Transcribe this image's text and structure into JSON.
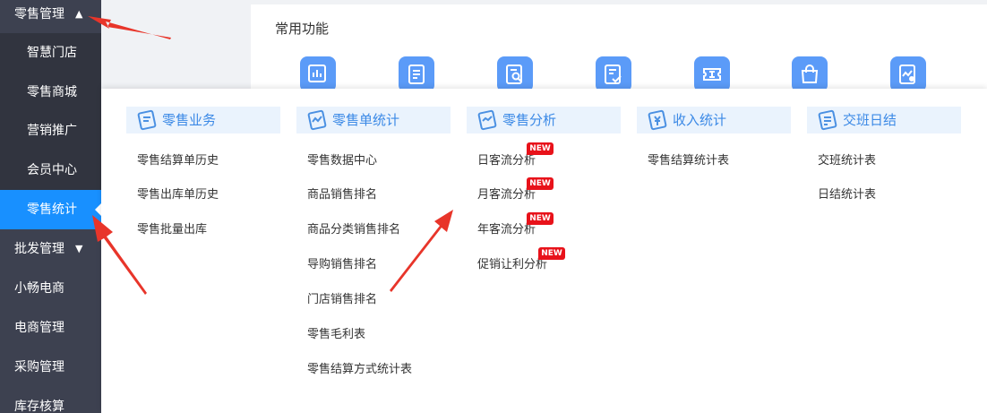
{
  "sidebar": {
    "retail_mgmt": "零售管理",
    "items": [
      "智慧门店",
      "零售商城",
      "营销推广",
      "会员中心",
      "零售统计"
    ],
    "groups": [
      "批发管理",
      "小畅电商",
      "电商管理",
      "采购管理",
      "库存核算"
    ]
  },
  "main": {
    "common_functions": "常用功能",
    "icons": [
      "report-chart-icon",
      "document-list-icon",
      "search-doc-icon",
      "checklist-icon",
      "ticket-icon",
      "shopping-bag-icon",
      "analytics-icon"
    ]
  },
  "menu": {
    "columns": [
      {
        "title": "零售业务",
        "items": [
          "零售结算单历史",
          "零售出库单历史",
          "零售批量出库"
        ]
      },
      {
        "title": "零售单统计",
        "items": [
          "零售数据中心",
          "商品销售排名",
          "商品分类销售排名",
          "导购销售排名",
          "门店销售排名",
          "零售毛利表",
          "零售结算方式统计表"
        ]
      },
      {
        "title": "零售分析",
        "items": [
          "日客流分析",
          "月客流分析",
          "年客流分析",
          "促销让利分析"
        ]
      },
      {
        "title": "收入统计",
        "items": [
          "零售结算统计表"
        ]
      },
      {
        "title": "交班日结",
        "items": [
          "交班统计表",
          "日结统计表"
        ]
      }
    ],
    "new_badge": "NEW"
  },
  "colors": {
    "sidebar": "#3d4150",
    "active": "#1890ff",
    "accent": "#3b89e6",
    "arrow": "#e8352a"
  }
}
